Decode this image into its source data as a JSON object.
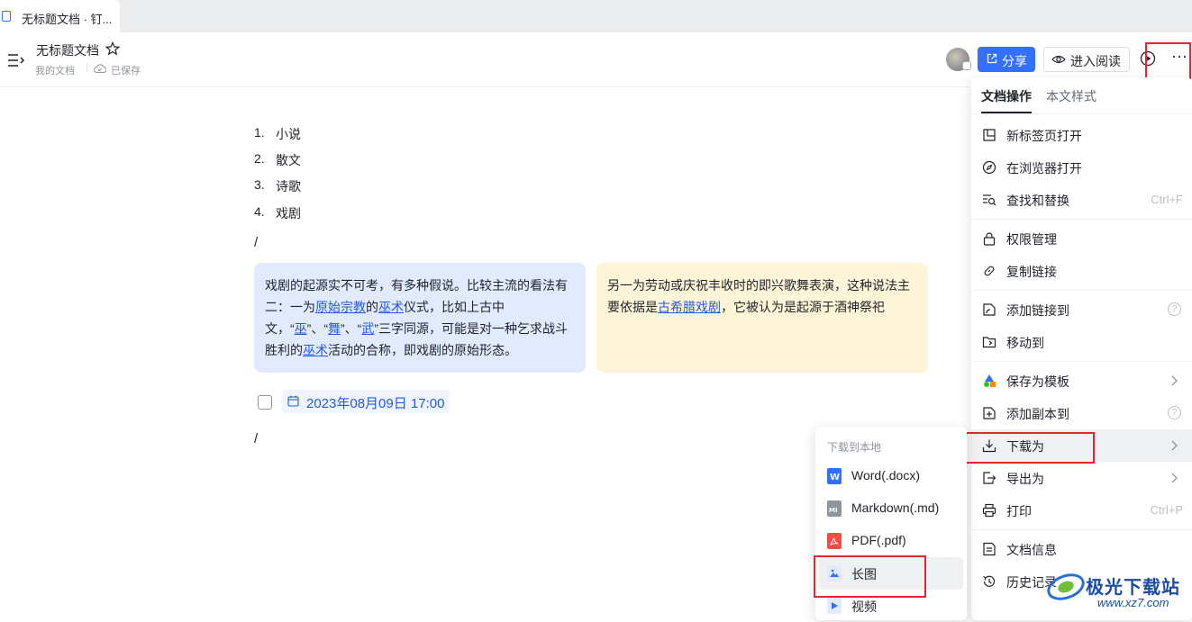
{
  "tab": {
    "title": "无标题文档 · 钉..."
  },
  "header": {
    "title": "无标题文档",
    "breadcrumb": "我的文档",
    "save_status": "已保存",
    "share_label": "分享",
    "read_label": "进入阅读",
    "more_label": "···"
  },
  "doc": {
    "list": [
      {
        "num": "1.",
        "text": "小说"
      },
      {
        "num": "2.",
        "text": "散文"
      },
      {
        "num": "3.",
        "text": "诗歌"
      },
      {
        "num": "4.",
        "text": "戏剧"
      }
    ],
    "slash1": "/",
    "slash2": "/",
    "callout_blue": {
      "t1": "戏剧的起源实不可考，有多种假说。比较主流的看法有二：一为",
      "l1": "原始宗教",
      "t2": "的",
      "l2": "巫术",
      "t3": "仪式，比如上古中文，“",
      "l3": "巫",
      "t4": "”、“",
      "l4": "舞",
      "t5": "”、“",
      "l5": "武",
      "t6": "”三字同源，可能是对一种乞求战斗胜利的",
      "l6": "巫术",
      "t7": "活动的合称，即戏剧的原始形态。"
    },
    "callout_yellow": {
      "t1": "另一为劳动或庆祝丰收时的即兴歌舞表演，这种说法主要依据是",
      "l1": "古希腊戏剧",
      "t2": "，它被认为是起源于酒神祭祀"
    },
    "date": "2023年08月09日 17:00"
  },
  "panel": {
    "tab_active": "文档操作",
    "tab_inactive": "本文样式",
    "items": {
      "new_tab": "新标签页打开",
      "browser": "在浏览器打开",
      "find": "查找和替换",
      "find_shortcut": "Ctrl+F",
      "permission": "权限管理",
      "copy_link": "复制链接",
      "add_link": "添加链接到",
      "move": "移动到",
      "save_template": "保存为模板",
      "add_copy": "添加副本到",
      "download": "下载为",
      "export": "导出为",
      "print": "打印",
      "print_shortcut": "Ctrl+P",
      "info": "文档信息",
      "history": "历史记录",
      "help_glyph": "?"
    }
  },
  "submenu": {
    "heading": "下载到本地",
    "items": [
      {
        "label": "Word(.docx)"
      },
      {
        "label": "Markdown(.md)"
      },
      {
        "label": "PDF(.pdf)"
      },
      {
        "label": "长图"
      },
      {
        "label": "视频"
      }
    ]
  },
  "watermark": {
    "name": "极光下载站",
    "url": "www.xz7.com"
  },
  "colors": {
    "accent": "#3370ff",
    "highlight_box": "#e3262f",
    "callout_blue": "#e1eaff",
    "callout_yellow": "#fef5d9"
  }
}
